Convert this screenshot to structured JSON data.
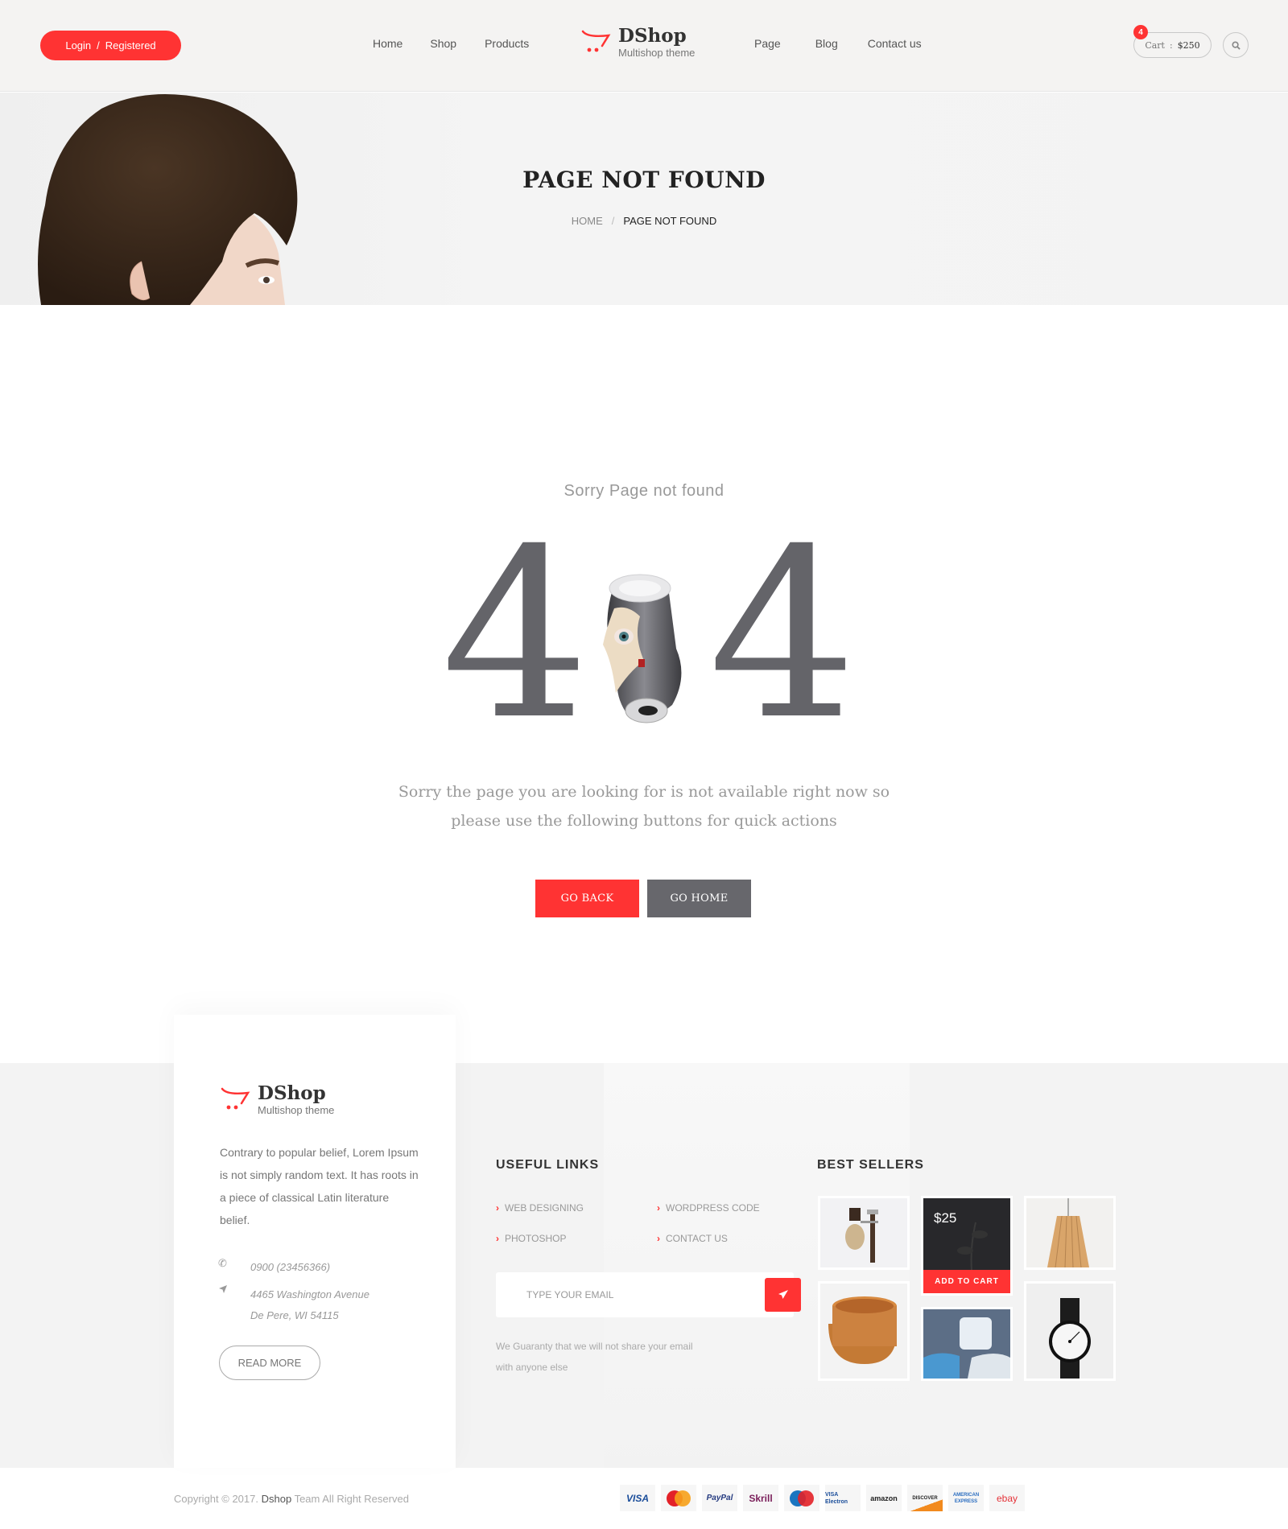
{
  "header": {
    "login_label": "Login",
    "login_separator": "/",
    "register_label": "Registered",
    "nav_left": [
      "Home",
      "Shop",
      "Products"
    ],
    "nav_right": [
      "Page",
      "Blog",
      "Contact us"
    ],
    "logo_name": "DShop",
    "logo_tagline": "Multishop theme",
    "cart_label": "Cart",
    "cart_separator": ":",
    "cart_total": "$250",
    "cart_count": "4",
    "search_icon": "search-icon"
  },
  "banner": {
    "title": "PAGE NOT FOUND",
    "breadcrumb": {
      "home": "HOME",
      "separator": "/",
      "current": "PAGE NOT FOUND"
    }
  },
  "error": {
    "subtitle": "Sorry Page not found",
    "code_left": "4",
    "code_right": "4",
    "description_line1": "Sorry the page you are looking for is not available right now so",
    "description_line2": "please use the following buttons for quick actions",
    "go_back_label": "GO BACK",
    "go_home_label": "GO HOME"
  },
  "footer": {
    "logo_name": "DShop",
    "logo_tagline": "Multishop theme",
    "about_text": "Contrary to popular belief, Lorem Ipsum is not simply random text. It has roots in a piece of classical Latin literature belief.",
    "phone": "0900 (23456366)",
    "address_line1": "4465 Washington Avenue",
    "address_line2": "De Pere, WI 54115",
    "read_more_label": "READ MORE",
    "useful_links_title": "USEFUL LINKS",
    "useful_links": [
      "WEB DESIGNING",
      "WORDPRESS CODE",
      "PHOTOSHOP",
      "CONTACT US"
    ],
    "email_placeholder": "TYPE YOUR EMAIL",
    "guarantee_line1": "We Guaranty that we will not share your email",
    "guarantee_line2": "with anyone else",
    "best_sellers_title": "BEST SELLERS",
    "best_sellers": [
      {
        "name": "shaving-set"
      },
      {
        "name": "plant",
        "price": "$25",
        "cta": "ADD TO CART"
      },
      {
        "name": "wooden-lamp"
      },
      {
        "name": "wooden-cup"
      },
      {
        "name": "mugs"
      },
      {
        "name": "wrist-watch"
      }
    ],
    "copyright_prefix": "Copyright © 2017.",
    "copyright_brand": "Dshop",
    "copyright_suffix": "Team All Right Reserved",
    "payment_methods": [
      "VISA",
      "MasterCard",
      "PayPal",
      "Skrill",
      "Maestro",
      "VISA Electron",
      "amazon",
      "DISCOVER",
      "AMERICAN EXPRESS",
      "ebay"
    ]
  },
  "colors": {
    "accent": "#ff3333",
    "dark_button": "#67676c",
    "numeral": "#646469"
  }
}
